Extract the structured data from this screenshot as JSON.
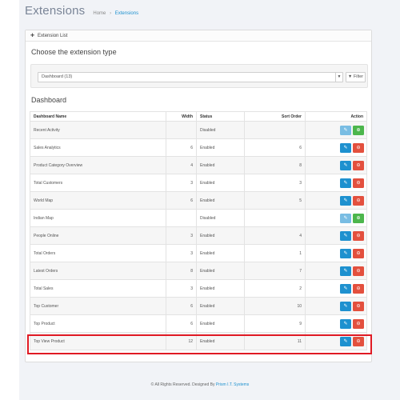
{
  "page": {
    "title": "Extensions",
    "breadcrumb": [
      {
        "label": "Home"
      },
      {
        "label": "Extensions"
      }
    ]
  },
  "panel": {
    "heading": "Extension List",
    "choose_title": "Choose the extension type",
    "select_value": "Dashboard (13)",
    "filter_label": "Filter",
    "section_title": "Dashboard"
  },
  "table": {
    "columns": [
      "Dashboard Name",
      "Width",
      "Status",
      "Sort Order",
      "Action"
    ],
    "rows": [
      {
        "name": "Recent Activity",
        "width": "",
        "status": "Disabled",
        "sort": "",
        "installed": false
      },
      {
        "name": "Sales Analytics",
        "width": "6",
        "status": "Enabled",
        "sort": "6",
        "installed": true
      },
      {
        "name": "Product Category Overview",
        "width": "4",
        "status": "Enabled",
        "sort": "8",
        "installed": true
      },
      {
        "name": "Total Customers",
        "width": "3",
        "status": "Enabled",
        "sort": "3",
        "installed": true
      },
      {
        "name": "World Map",
        "width": "6",
        "status": "Enabled",
        "sort": "5",
        "installed": true
      },
      {
        "name": "Indian Map",
        "width": "",
        "status": "Disabled",
        "sort": "",
        "installed": false
      },
      {
        "name": "People Online",
        "width": "3",
        "status": "Enabled",
        "sort": "4",
        "installed": true
      },
      {
        "name": "Total Orders",
        "width": "3",
        "status": "Enabled",
        "sort": "1",
        "installed": true
      },
      {
        "name": "Latest Orders",
        "width": "8",
        "status": "Enabled",
        "sort": "7",
        "installed": true
      },
      {
        "name": "Total Sales",
        "width": "3",
        "status": "Enabled",
        "sort": "2",
        "installed": true
      },
      {
        "name": "Top Customer",
        "width": "6",
        "status": "Enabled",
        "sort": "10",
        "installed": true
      },
      {
        "name": "Top Product",
        "width": "6",
        "status": "Enabled",
        "sort": "9",
        "installed": true
      },
      {
        "name": "Top View Product",
        "width": "12",
        "status": "Enabled",
        "sort": "11",
        "installed": true
      }
    ]
  },
  "footer": {
    "text": "© All Rights Reserved. Designed By",
    "link": "Prism I.T. Systems"
  },
  "colors": {
    "primary": "#1e91cf",
    "danger": "#e3503e",
    "success": "#4cb64c",
    "highlight": "#e01a24"
  }
}
